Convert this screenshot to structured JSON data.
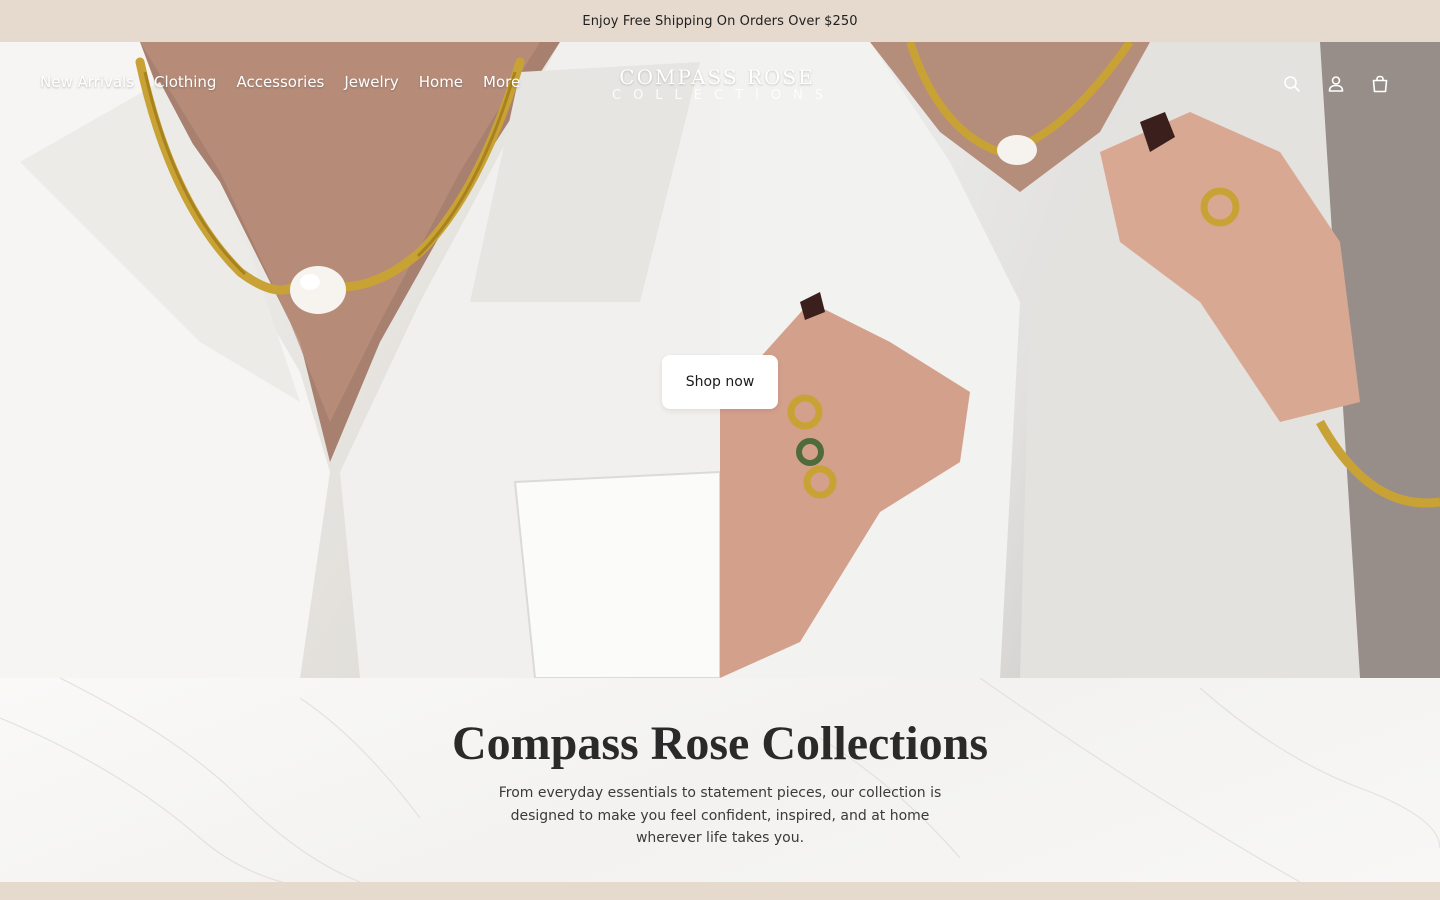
{
  "announcement": {
    "text": "Enjoy Free Shipping On Orders Over $250"
  },
  "nav": {
    "items": [
      {
        "label": "New Arrivals"
      },
      {
        "label": "Clothing"
      },
      {
        "label": "Accessories"
      },
      {
        "label": "Jewelry"
      },
      {
        "label": "Home"
      },
      {
        "label": "More"
      }
    ]
  },
  "logo": {
    "line1": "COMPASS ROSE",
    "line2": "COLLECTIONS"
  },
  "header_icons": [
    "search-icon",
    "account-icon",
    "cart-icon"
  ],
  "hero": {
    "cta_label": "Shop now"
  },
  "intro": {
    "title": "Compass Rose Collections",
    "text": "From everyday essentials to statement pieces, our collection is designed to make you feel confident, inspired, and at home wherever life takes you."
  },
  "colors": {
    "announcement_bg": "#e6d9cd",
    "gold": "#c9a235",
    "text_dark": "#2a2a2a"
  }
}
